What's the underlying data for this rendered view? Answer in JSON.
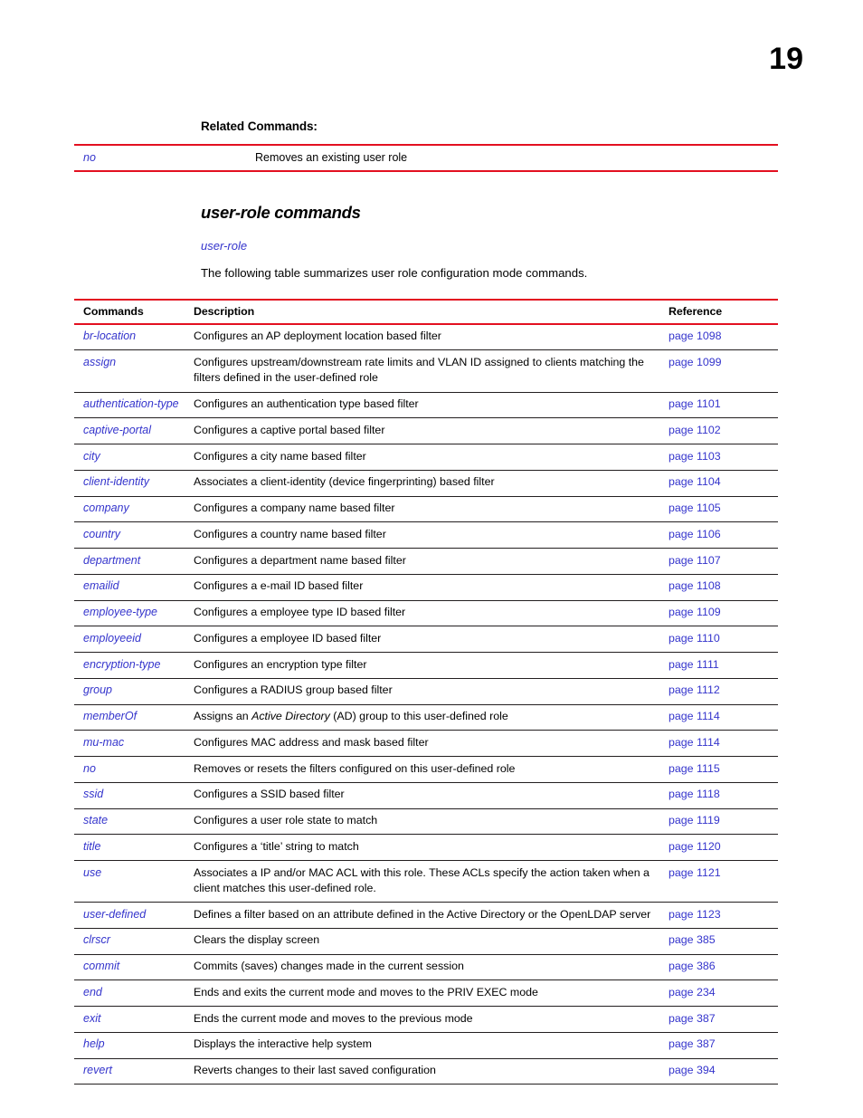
{
  "page": {
    "number": "19"
  },
  "related": {
    "heading": "Related Commands:",
    "rows": [
      {
        "command": "no",
        "description": "Removes an existing user role"
      }
    ]
  },
  "section": {
    "title": "user-role commands",
    "sublink": "user-role",
    "intro": "The following table summarizes user role configuration mode commands."
  },
  "table": {
    "headers": {
      "commands": "Commands",
      "description": "Description",
      "reference": "Reference"
    },
    "rows": [
      {
        "command": "br-location",
        "description": "Configures an AP deployment location based filter",
        "reference": "page 1098"
      },
      {
        "command": "assign",
        "description": "Configures upstream/downstream rate limits and VLAN ID assigned to clients matching the filters defined in the user-defined role",
        "reference": "page 1099"
      },
      {
        "command": "authentication-type",
        "description": "Configures an authentication type based filter",
        "reference": "page 1101"
      },
      {
        "command": "captive-portal",
        "description": "Configures a captive portal based filter",
        "reference": "page 1102"
      },
      {
        "command": "city",
        "description": "Configures a city name based filter",
        "reference": "page 1103"
      },
      {
        "command": "client-identity",
        "description": "Associates a client-identity (device fingerprinting) based filter",
        "reference": "page 1104"
      },
      {
        "command": "company",
        "description": "Configures a company name based filter",
        "reference": "page 1105"
      },
      {
        "command": "country",
        "description": "Configures a country name based filter",
        "reference": "page 1106"
      },
      {
        "command": "department",
        "description": "Configures a department name based filter",
        "reference": "page 1107"
      },
      {
        "command": "emailid",
        "description": "Configures a e-mail ID based filter",
        "reference": "page 1108"
      },
      {
        "command": "employee-type",
        "description": "Configures a employee type ID based filter",
        "reference": "page 1109"
      },
      {
        "command": "employeeid",
        "description": "Configures a employee ID based filter",
        "reference": "page 1110"
      },
      {
        "command": "encryption-type",
        "description": "Configures an encryption type filter",
        "reference": "page 1111"
      },
      {
        "command": "group",
        "description": "Configures a RADIUS group based filter",
        "reference": "page 1112"
      },
      {
        "command": "memberOf",
        "description": "Assigns an Active Directory (AD) group to this user-defined role",
        "description_parts": [
          {
            "t": "Assigns an ",
            "i": false
          },
          {
            "t": "Active Directory",
            "i": true
          },
          {
            "t": " (AD) group to this user-defined role",
            "i": false
          }
        ],
        "reference": "page 1114"
      },
      {
        "command": "mu-mac",
        "description": "Configures MAC address and mask based filter",
        "reference": "page 1114"
      },
      {
        "command": "no",
        "description": "Removes or resets the filters configured on this user-defined role",
        "reference": "page 1115"
      },
      {
        "command": "ssid",
        "description": "Configures a SSID based filter",
        "reference": "page 1118"
      },
      {
        "command": "state",
        "description": "Configures a user role state to match",
        "reference": "page 1119"
      },
      {
        "command": "title",
        "description": "Configures a ‘title’ string to match",
        "reference": "page 1120"
      },
      {
        "command": "use",
        "description": "Associates a IP and/or MAC ACL with this role. These ACLs specify the action taken when a client matches this user-defined role.",
        "reference": "page 1121"
      },
      {
        "command": "user-defined",
        "description": "Defines a filter based on an attribute defined in the Active Directory or the OpenLDAP server",
        "reference": "page 1123"
      },
      {
        "command": "clrscr",
        "description": "Clears the display screen",
        "reference": "page 385"
      },
      {
        "command": "commit",
        "description": "Commits (saves) changes made in the current session",
        "reference": "page 386"
      },
      {
        "command": "end",
        "description": "Ends and exits the current mode and moves to the PRIV EXEC mode",
        "reference": "page 234"
      },
      {
        "command": "exit",
        "description": "Ends the current mode and moves to the previous mode",
        "reference": "page 387"
      },
      {
        "command": "help",
        "description": "Displays the interactive help system",
        "reference": "page 387"
      },
      {
        "command": "revert",
        "description": "Reverts changes to their last saved configuration",
        "reference": "page 394"
      }
    ]
  },
  "colors": {
    "link": "#3434CC",
    "rule_red": "#E31020",
    "rule_black": "#231f20",
    "text": "#000000"
  }
}
